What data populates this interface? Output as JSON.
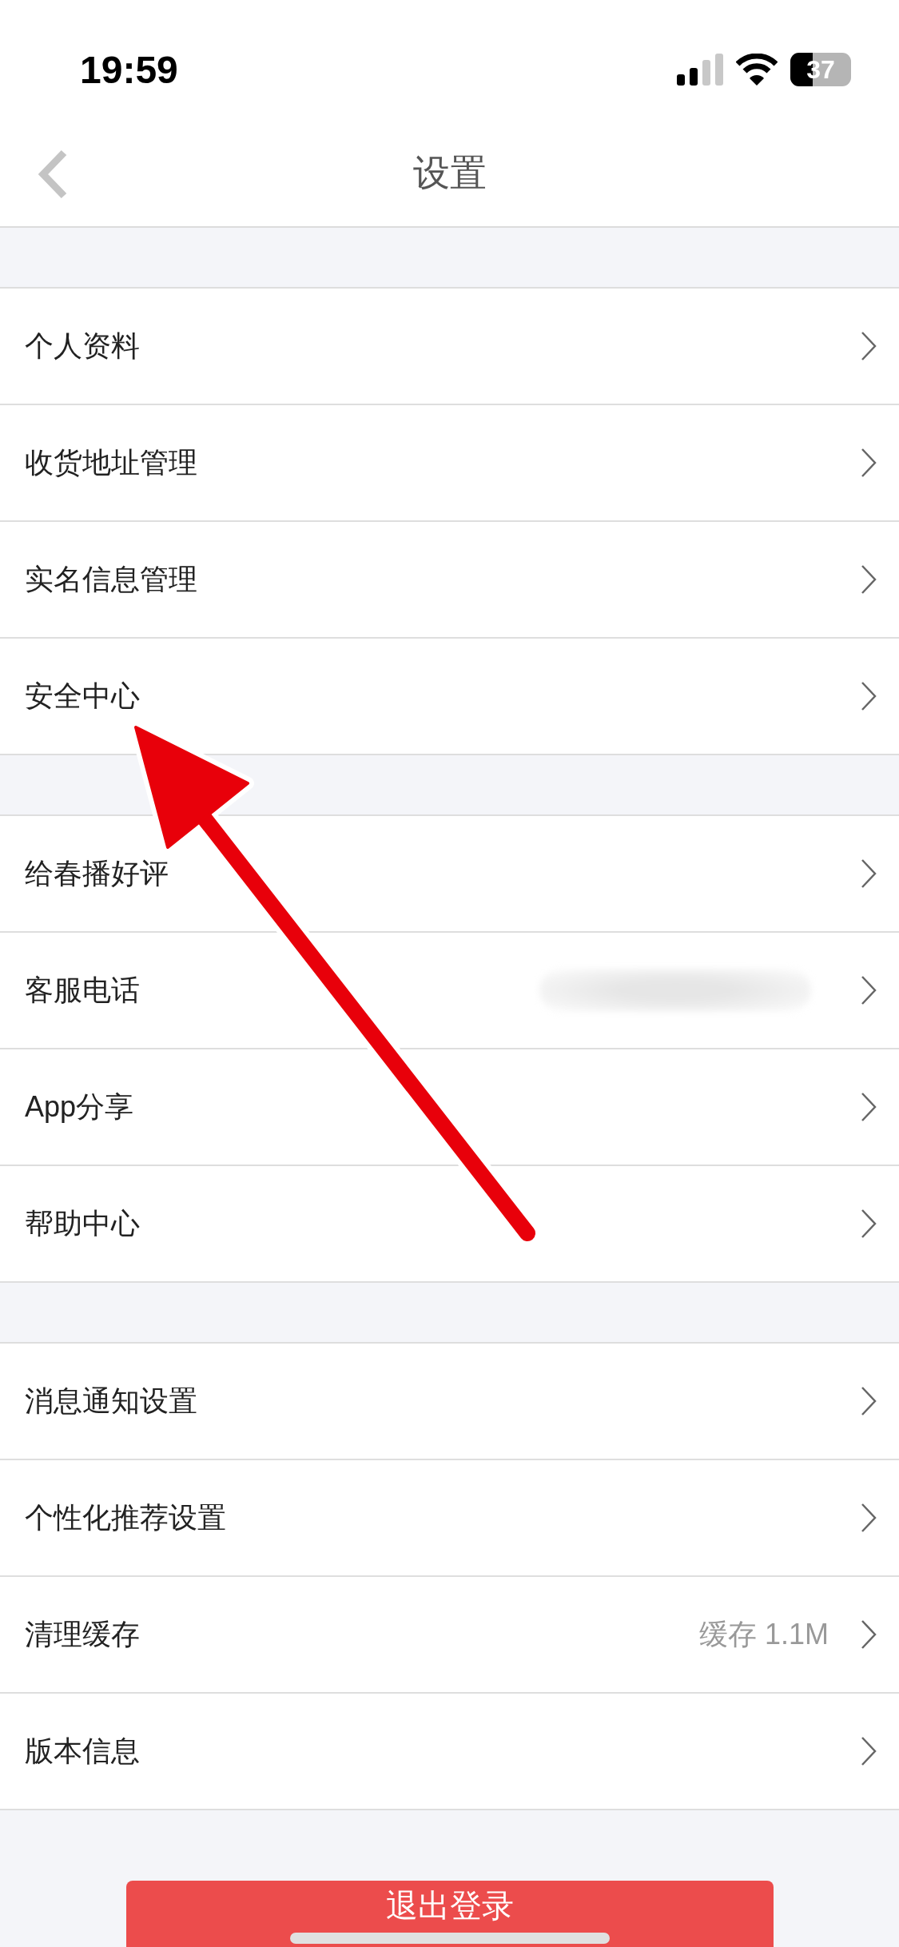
{
  "status_bar": {
    "time": "19:59",
    "battery": "37"
  },
  "nav": {
    "title": "设置"
  },
  "groups": [
    {
      "rows": [
        {
          "label": "个人资料"
        },
        {
          "label": "收货地址管理"
        },
        {
          "label": "实名信息管理"
        },
        {
          "label": "安全中心"
        }
      ]
    },
    {
      "rows": [
        {
          "label": "给春播好评"
        },
        {
          "label": "客服电话",
          "redacted": true
        },
        {
          "label": "App分享"
        },
        {
          "label": "帮助中心"
        }
      ]
    },
    {
      "rows": [
        {
          "label": "消息通知设置"
        },
        {
          "label": "个性化推荐设置"
        },
        {
          "label": "清理缓存",
          "value": "缓存 1.1M"
        },
        {
          "label": "版本信息"
        }
      ]
    }
  ],
  "logout_button": "退出登录"
}
